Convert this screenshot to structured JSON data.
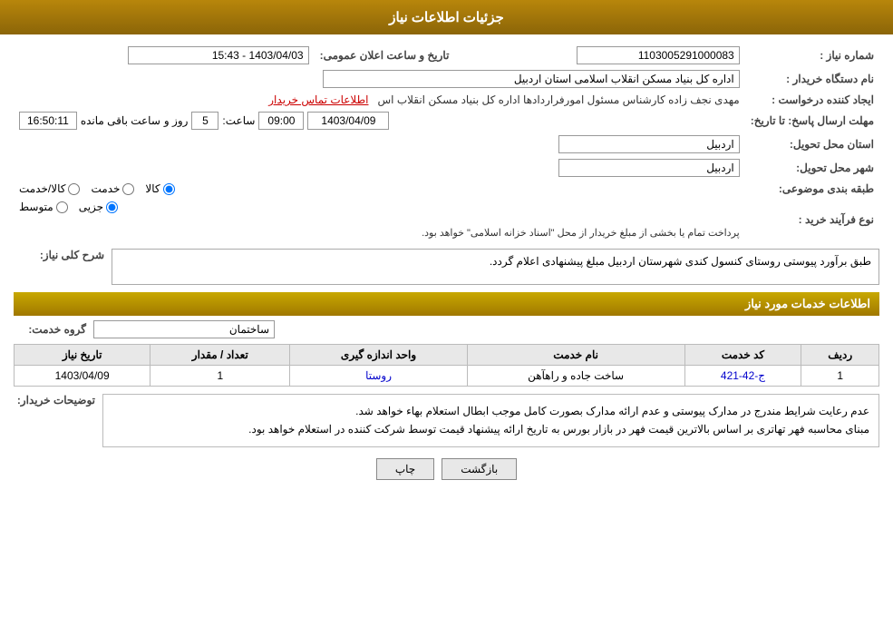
{
  "header": {
    "title": "جزئیات اطلاعات نیاز"
  },
  "fields": {
    "shomara_niaz_label": "شماره نیاز :",
    "shomara_niaz_value": "1103005291000083",
    "nam_dastgah_label": "نام دستگاه خریدار :",
    "nam_dastgah_value": "اداره کل بنیاد مسکن انقلاب اسلامی استان اردبیل",
    "ijad_konande_label": "ایجاد کننده درخواست :",
    "ijad_konande_value": "مهدی نجف زاده کارشناس مسئول امورفراردادها اداره کل بنیاد مسکن انقلاب اس",
    "contact_info_label": "اطلاعات تماس خریدار",
    "tarikh_label": "مهلت ارسال پاسخ: تا تاریخ:",
    "tarikh_value": "1403/04/09",
    "saat_label": "ساعت:",
    "saat_value": "09:00",
    "ruz_label": "روز و",
    "ruz_value": "5",
    "mande_label": "ساعت باقی مانده",
    "mande_value": "16:50:11",
    "tarikh_elam_label": "تاریخ و ساعت اعلان عمومی:",
    "tarikh_elam_value": "1403/04/03 - 15:43",
    "ostan_label": "استان محل تحویل:",
    "ostan_value": "اردبیل",
    "shahr_label": "شهر محل تحویل:",
    "shahr_value": "اردبیل",
    "tabaqe_label": "طبقه بندی موضوعی:",
    "kala_label": "کالا",
    "khedmat_label": "خدمت",
    "kala_khedmat_label": "کالا/خدمت",
    "radio_kala": "کالا",
    "radio_khedmat": "خدمت",
    "radio_kala_khedmat": "کالا/خدمت",
    "noow_farayand_label": "نوع فرآیند خرید :",
    "jozi_label": "جزیی",
    "motavasset_label": "متوسط",
    "pardakht_label": "پرداخت تمام یا بخشی از مبلغ خریدار از محل \"اسناد خزانه اسلامی\" خواهد بود.",
    "sharh_label": "شرح کلی نیاز:",
    "sharh_value": "طبق برآورد پیوستی روستای کنسول کندی شهرستان اردبیل مبلغ پیشنهادی اعلام گردد.",
    "khedamat_label": "اطلاعات خدمات مورد نیاز",
    "grooh_label": "گروه خدمت:",
    "grooh_value": "ساختمان",
    "table_headers": {
      "radif": "ردیف",
      "code_khedmat": "کد خدمت",
      "nam_khedmat": "نام خدمت",
      "vahed_andaze": "واحد اندازه گیری",
      "tedad_megdar": "تعداد / مقدار",
      "tarikh_niaz": "تاریخ نیاز"
    },
    "table_rows": [
      {
        "radif": "1",
        "code_khedmat": "ج-42-421",
        "nam_khedmat": "ساخت جاده و راهآهن",
        "vahed_andaze": "روستا",
        "tedad_megdar": "1",
        "tarikh_niaz": "1403/04/09"
      }
    ],
    "buyer_desc_label": "توضیحات خریدار:",
    "buyer_desc_value1": "عدم رعایت شرایط مندرج در مدارک پیوستی و عدم ارائه مدارک بصورت کامل موجب ابطال استعلام بهاء خواهد شد.",
    "buyer_desc_value2": "مبنای محاسبه فهر تهاتری بر اساس بالاترین قیمت فهر در بازار بورس به تاریخ ارائه پیشنهاد قیمت توسط شرکت کننده در استعلام خواهد بود.",
    "btn_back": "بازگشت",
    "btn_print": "چاپ"
  }
}
